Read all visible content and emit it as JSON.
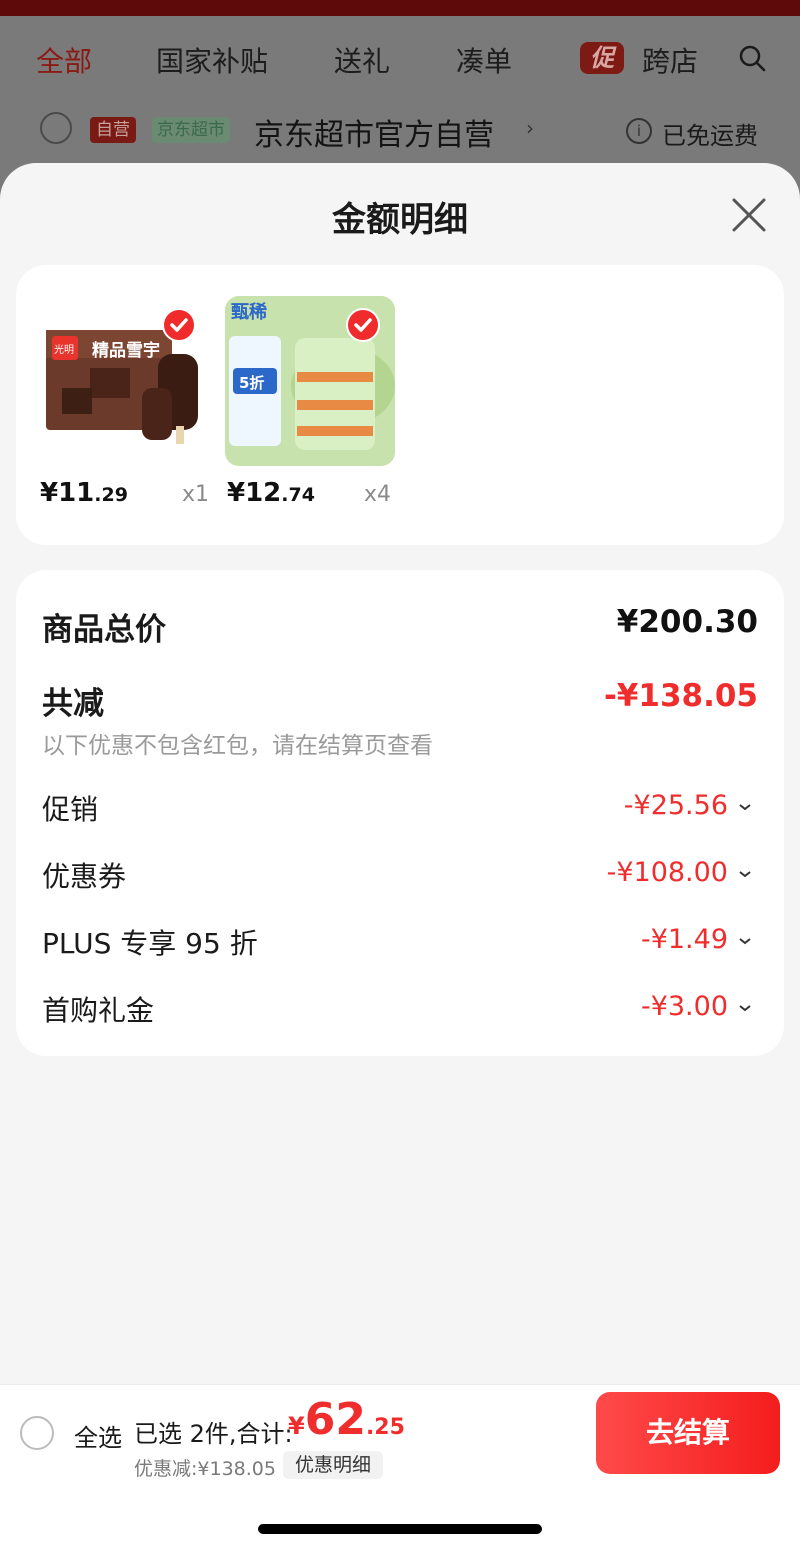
{
  "background": {
    "tabs": [
      "全部",
      "国家补贴",
      "送礼",
      "凑单",
      "跨店"
    ],
    "promo_badge": "促",
    "store": {
      "tag_self": "自营",
      "tag_market": "京东超市",
      "name": "京东超市官方自营",
      "arrow": "›",
      "info": "i",
      "shipping": "已免运费"
    }
  },
  "sheet": {
    "title": "金额明细",
    "products": [
      {
        "price_int": "¥11",
        "price_dec": ".29",
        "qty": "x1",
        "brand": "光明",
        "name": "精品雪宇"
      },
      {
        "price_int": "¥12",
        "price_dec": ".74",
        "qty": "x4",
        "brand": "甄稀",
        "badge": "5折"
      }
    ],
    "summary": {
      "total_label": "商品总价",
      "total_value": "¥200.30",
      "reduce_label": "共减",
      "reduce_value": "-¥138.05",
      "note": "以下优惠不包含红包，请在结算页查看",
      "discounts": [
        {
          "label": "促销",
          "value": "-¥25.56"
        },
        {
          "label": "优惠券",
          "value": "-¥108.00"
        },
        {
          "label": "PLUS 专享 95 折",
          "value": "-¥1.49"
        },
        {
          "label": "首购礼金",
          "value": "-¥3.00"
        }
      ]
    }
  },
  "bottom": {
    "select_all": "全选",
    "selected_count": "已选 2件,合计:",
    "total_currency": "¥",
    "total_int": "62",
    "total_dec": ".25",
    "discount_text": "优惠减:¥138.05",
    "detail_button": "优惠明细",
    "checkout_button": "去结算"
  },
  "colors": {
    "accent_red": "#f02d2d",
    "checkout_red": "#ff3b3b"
  }
}
